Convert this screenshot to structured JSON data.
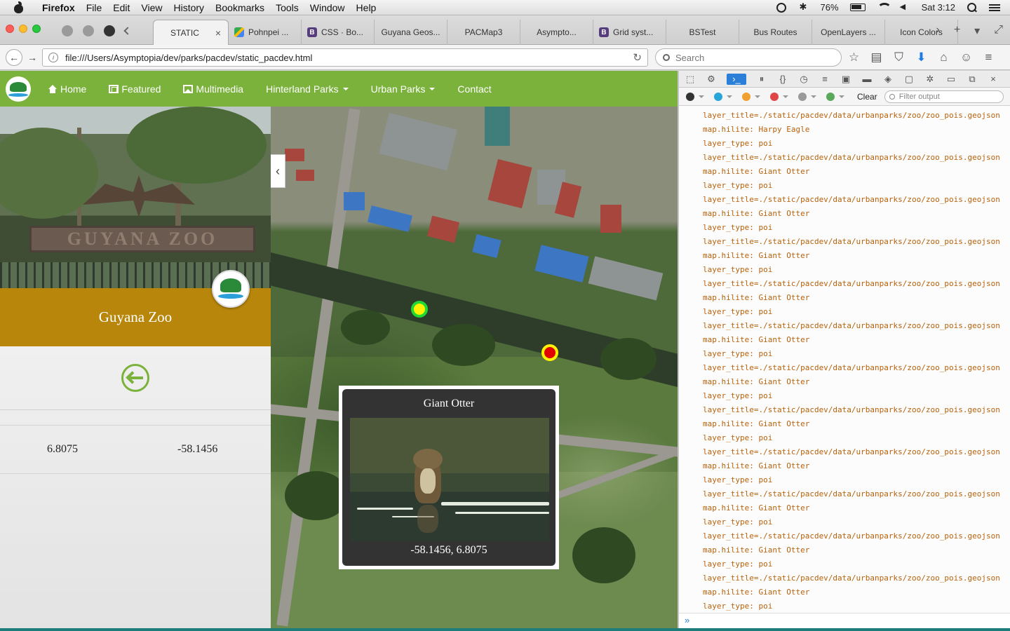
{
  "menubar": {
    "app": "Firefox",
    "items": [
      "File",
      "Edit",
      "View",
      "History",
      "Bookmarks",
      "Tools",
      "Window",
      "Help"
    ],
    "battery": "76%",
    "clock": "Sat 3:12"
  },
  "tabs": [
    {
      "label": "STATIC",
      "active": true
    },
    {
      "label": "Pohnpei ..."
    },
    {
      "label": "CSS · Bo..."
    },
    {
      "label": "Guyana Geos..."
    },
    {
      "label": "PACMap3"
    },
    {
      "label": "Asympto..."
    },
    {
      "label": "Grid syst..."
    },
    {
      "label": "BSTest"
    },
    {
      "label": "Bus Routes"
    },
    {
      "label": "OpenLayers ..."
    },
    {
      "label": "Icon Colors"
    }
  ],
  "navbar": {
    "url": "file:///Users/Asymptopia/dev/parks/pacdev/static_pacdev.html",
    "search_placeholder": "Search"
  },
  "site_nav": {
    "home": "Home",
    "featured": "Featured",
    "multimedia": "Multimedia",
    "hinterland": "Hinterland Parks",
    "urban": "Urban Parks",
    "contact": "Contact"
  },
  "sidebar": {
    "sign_text": "GUYANA ZOO",
    "park_title": "Guyana Zoo",
    "lat": "6.8075",
    "lon": "-58.1456"
  },
  "popup": {
    "title": "Giant Otter",
    "coords": "-58.1456, 6.8075"
  },
  "devtools": {
    "clear": "Clear",
    "filter_placeholder": "Filter output",
    "filter_colors": [
      "#333333",
      "#2aa5d9",
      "#f0a030",
      "#e04545",
      "#9a9a9a",
      "#5aa85a"
    ],
    "log": [
      "layer_title=./static/pacdev/data/urbanparks/zoo/zoo_pois.geojson",
      "map.hilite: Harpy Eagle",
      "layer_type: poi",
      "layer_title=./static/pacdev/data/urbanparks/zoo/zoo_pois.geojson",
      "map.hilite: Giant Otter",
      "layer_type: poi",
      "layer_title=./static/pacdev/data/urbanparks/zoo/zoo_pois.geojson",
      "map.hilite: Giant Otter",
      "layer_type: poi",
      "layer_title=./static/pacdev/data/urbanparks/zoo/zoo_pois.geojson",
      "map.hilite: Giant Otter",
      "layer_type: poi",
      "layer_title=./static/pacdev/data/urbanparks/zoo/zoo_pois.geojson",
      "map.hilite: Giant Otter",
      "layer_type: poi",
      "layer_title=./static/pacdev/data/urbanparks/zoo/zoo_pois.geojson",
      "map.hilite: Giant Otter",
      "layer_type: poi",
      "layer_title=./static/pacdev/data/urbanparks/zoo/zoo_pois.geojson",
      "map.hilite: Giant Otter",
      "layer_type: poi",
      "layer_title=./static/pacdev/data/urbanparks/zoo/zoo_pois.geojson",
      "map.hilite: Giant Otter",
      "layer_type: poi",
      "layer_title=./static/pacdev/data/urbanparks/zoo/zoo_pois.geojson",
      "map.hilite: Giant Otter",
      "layer_type: poi",
      "layer_title=./static/pacdev/data/urbanparks/zoo/zoo_pois.geojson",
      "map.hilite: Giant Otter",
      "layer_type: poi",
      "layer_title=./static/pacdev/data/urbanparks/zoo/zoo_pois.geojson",
      "map.hilite: Giant Otter",
      "layer_type: poi",
      "layer_title=./static/pacdev/data/urbanparks/zoo/zoo_pois.geojson",
      "map.hilite: Giant Otter",
      "layer_type: poi",
      "layer_title=./static/pacdev/data/urbanparks/zoo/zoo_pois.geojson",
      "map.hilite: Giant Otter",
      "layer_type: poi"
    ]
  }
}
